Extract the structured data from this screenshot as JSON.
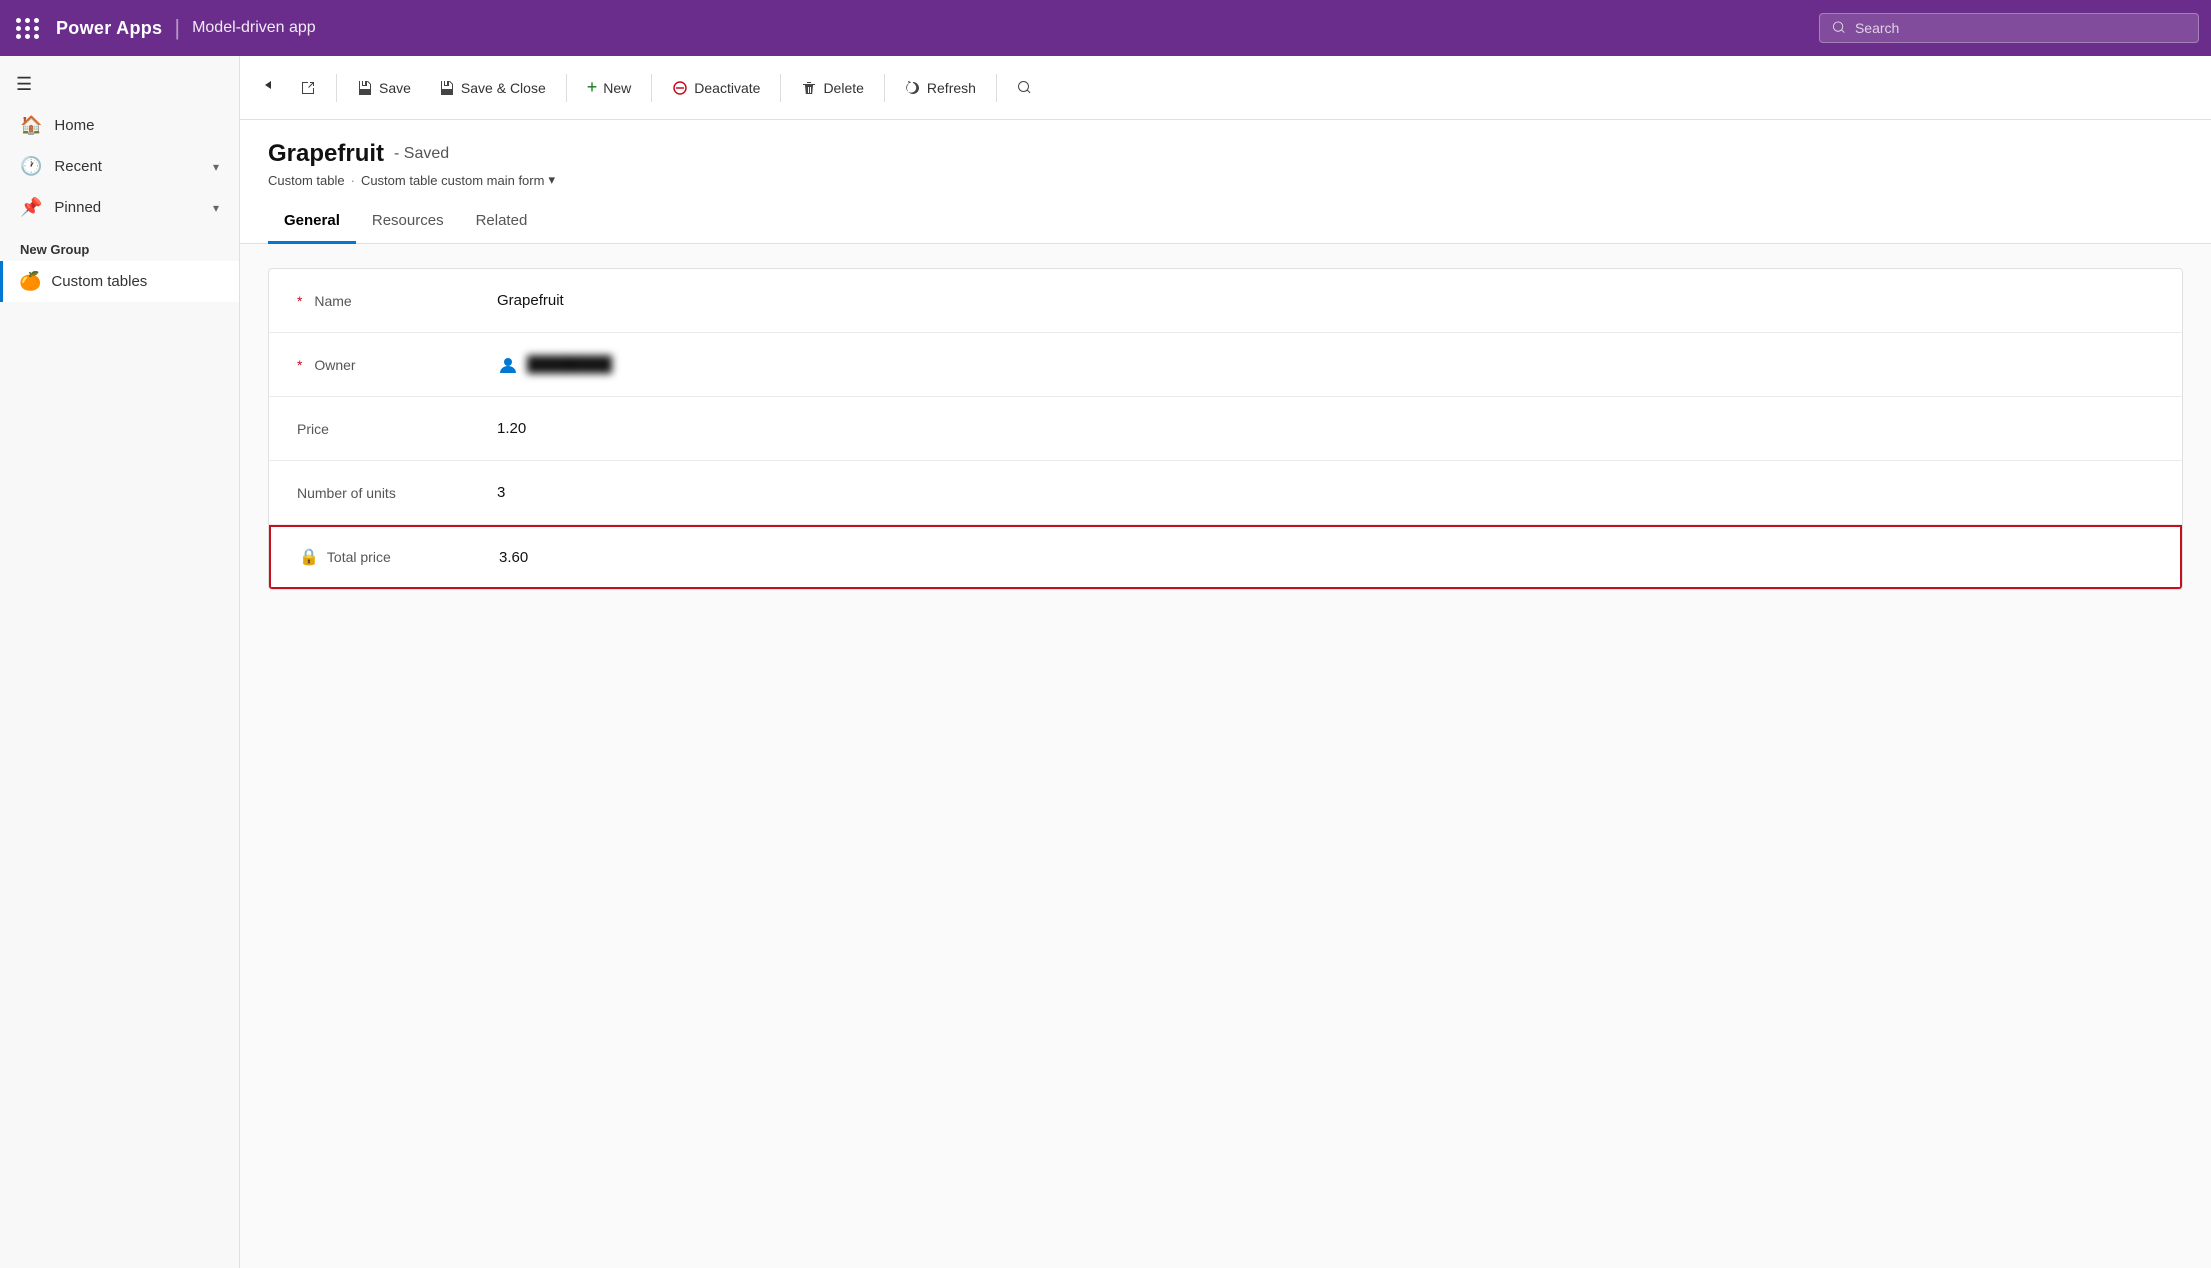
{
  "topNav": {
    "appName": "Power Apps",
    "appSubtitle": "Model-driven app",
    "searchPlaceholder": "Search"
  },
  "sidebar": {
    "navItems": [
      {
        "id": "home",
        "label": "Home",
        "icon": "🏠"
      },
      {
        "id": "recent",
        "label": "Recent",
        "icon": "🕐",
        "hasChevron": true
      },
      {
        "id": "pinned",
        "label": "Pinned",
        "icon": "📌",
        "hasChevron": true
      }
    ],
    "groupLabel": "New Group",
    "customTablesLabel": "Custom tables",
    "customTablesEmoji": "🍊"
  },
  "toolbar": {
    "backLabel": "←",
    "externalLabel": "↗",
    "saveLabel": "Save",
    "saveCloseLabel": "Save & Close",
    "newLabel": "New",
    "deactivateLabel": "Deactivate",
    "deleteLabel": "Delete",
    "refreshLabel": "Refresh",
    "searchLabel": "🔍"
  },
  "form": {
    "title": "Grapefruit",
    "savedBadge": "- Saved",
    "breadcrumb1": "Custom table",
    "breadcrumb2": "Custom table custom main form",
    "tabs": [
      {
        "id": "general",
        "label": "General",
        "active": true
      },
      {
        "id": "resources",
        "label": "Resources",
        "active": false
      },
      {
        "id": "related",
        "label": "Related",
        "active": false
      }
    ],
    "fields": [
      {
        "id": "name",
        "label": "Name",
        "required": true,
        "value": "Grapefruit",
        "type": "text"
      },
      {
        "id": "owner",
        "label": "Owner",
        "required": true,
        "value": "BLURRED_USER",
        "type": "owner"
      },
      {
        "id": "price",
        "label": "Price",
        "required": false,
        "value": "1.20",
        "type": "text"
      },
      {
        "id": "units",
        "label": "Number of units",
        "required": false,
        "value": "3",
        "type": "text"
      },
      {
        "id": "total",
        "label": "Total price",
        "required": false,
        "value": "3.60",
        "type": "total",
        "highlighted": true
      }
    ],
    "ownerBlurredText": "████████"
  }
}
